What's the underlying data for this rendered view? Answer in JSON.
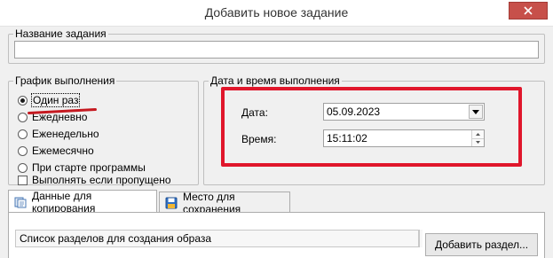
{
  "window": {
    "title": "Добавить новое задание",
    "close_icon": "close-icon"
  },
  "task_name": {
    "legend": "Название задания",
    "value": "",
    "placeholder": ""
  },
  "schedule": {
    "legend": "График выполнения",
    "options": [
      {
        "label": "Один раз",
        "checked": true
      },
      {
        "label": "Ежедневно",
        "checked": false
      },
      {
        "label": "Еженедельно",
        "checked": false
      },
      {
        "label": "Ежемесячно",
        "checked": false
      },
      {
        "label": "При старте программы",
        "checked": false
      }
    ],
    "run_if_missed": {
      "label": "Выполнять если пропущено",
      "checked": false
    }
  },
  "datetime": {
    "legend": "Дата и время выполнения",
    "date_label": "Дата:",
    "date_value": "05.09.2023",
    "time_label": "Время:",
    "time_value": "15:11:02"
  },
  "tabs": [
    {
      "label": "Данные для копирования",
      "icon": "copy-data-icon",
      "active": true
    },
    {
      "label": "Место для сохранения",
      "icon": "save-location-icon",
      "active": false
    }
  ],
  "copy_panel": {
    "list_header": "Список разделов для создания образа",
    "add_button": "Добавить раздел..."
  },
  "colors": {
    "annotation_red": "#e0162b",
    "close_button": "#c7504a"
  }
}
